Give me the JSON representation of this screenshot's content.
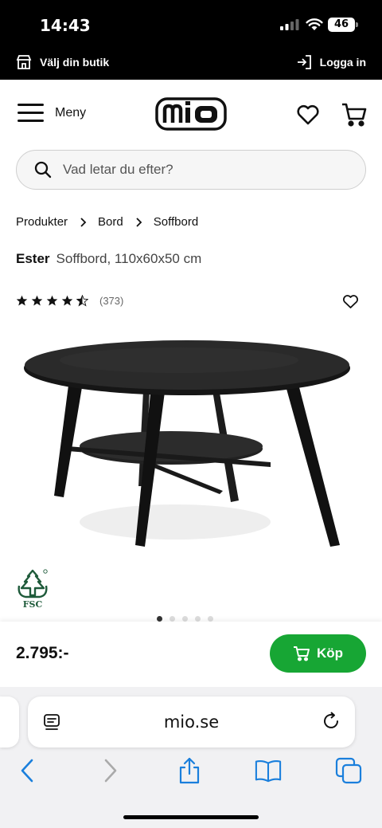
{
  "status": {
    "time": "14:43",
    "battery": "46"
  },
  "topbar": {
    "store_label": "Välj din butik",
    "login_label": "Logga in"
  },
  "header": {
    "menu_label": "Meny",
    "logo_text": "mio"
  },
  "search": {
    "placeholder": "Vad letar du efter?"
  },
  "breadcrumb": [
    "Produkter",
    "Bord",
    "Soffbord"
  ],
  "product": {
    "name": "Ester",
    "description": "Soffbord, 110x60x50 cm",
    "rating": 4.5,
    "review_count": "(373)",
    "image_count": 5,
    "active_image": 1,
    "fsc_label": "FSC"
  },
  "purchase": {
    "price": "2.795:-",
    "buy_label": "Köp"
  },
  "browser": {
    "url": "mio.se"
  },
  "colors": {
    "accent_green": "#17a634",
    "topbar_bg": "#000000",
    "browser_blue": "#1a7fdc"
  },
  "icons": [
    "store-icon",
    "login-icon",
    "menu-icon",
    "heart-icon",
    "cart-icon",
    "search-icon",
    "chevron-right-icon",
    "star-icon",
    "fsc-logo",
    "reader-icon",
    "reload-icon",
    "back-icon",
    "forward-icon",
    "share-icon",
    "bookmarks-icon",
    "tabs-icon"
  ]
}
